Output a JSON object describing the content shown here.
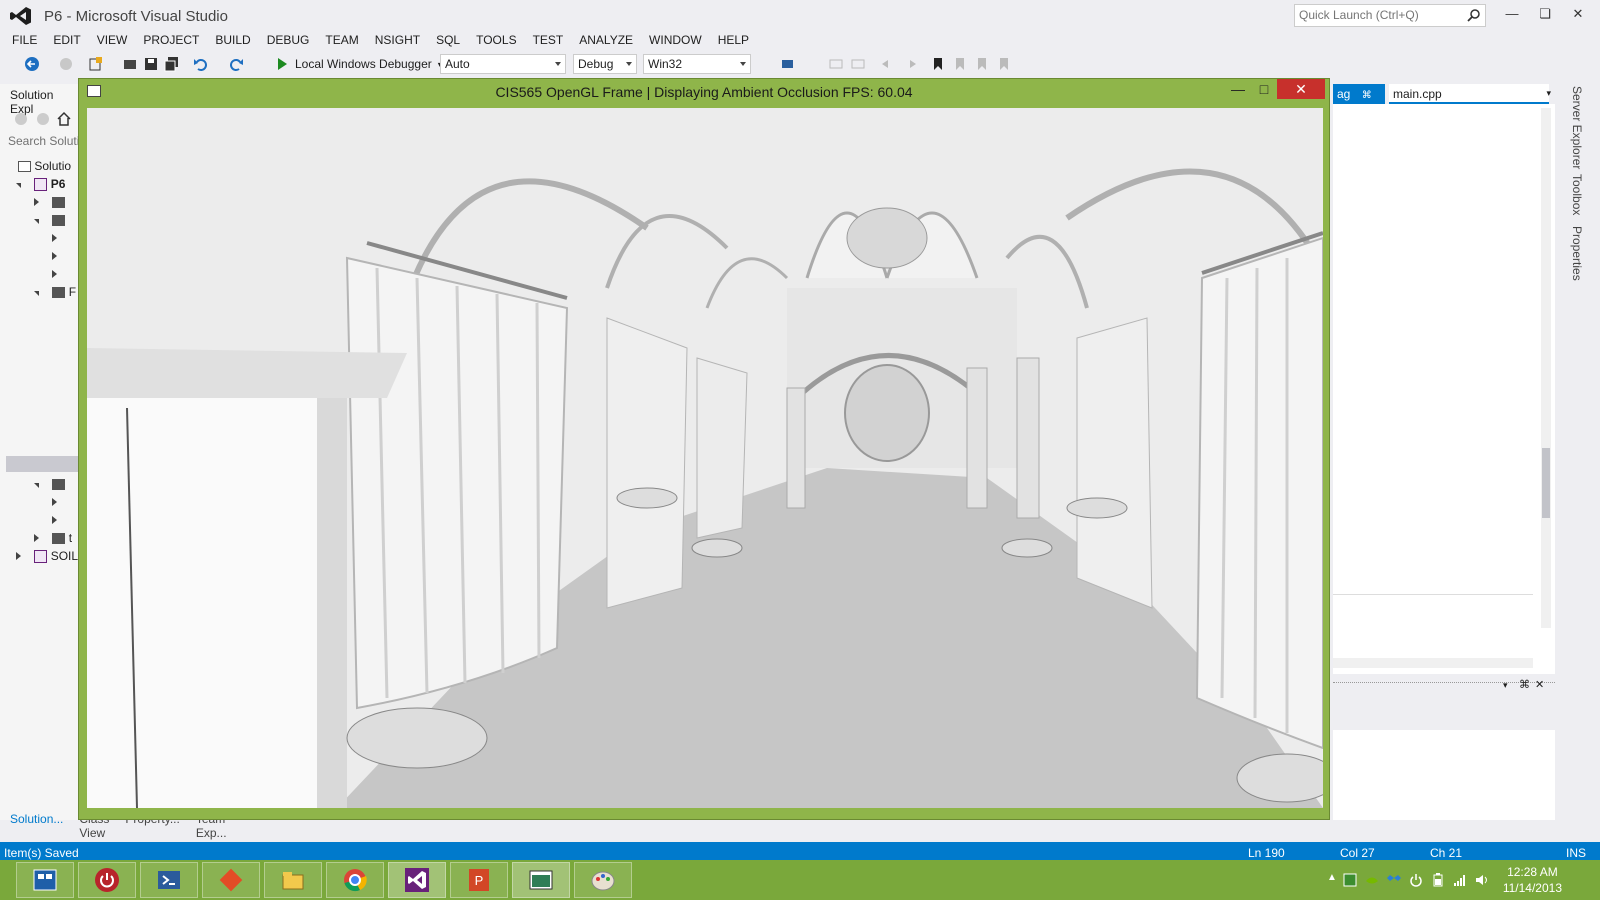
{
  "app": {
    "title": "P6 - Microsoft Visual Studio",
    "quick_launch_placeholder": "Quick Launch (Ctrl+Q)"
  },
  "menu": [
    "FILE",
    "EDIT",
    "VIEW",
    "PROJECT",
    "BUILD",
    "DEBUG",
    "TEAM",
    "NSIGHT",
    "SQL",
    "TOOLS",
    "TEST",
    "ANALYZE",
    "WINDOW",
    "HELP"
  ],
  "toolbar": {
    "debugger_label": "Local Windows Debugger",
    "config_auto": "Auto",
    "config_debug": "Debug",
    "platform": "Win32"
  },
  "solution_explorer": {
    "title": "Solution Expl",
    "search_placeholder": "Search Soluti",
    "solution_label": "Solutio",
    "project_label": "P6",
    "row_f": "F",
    "row_t": "t",
    "soil_label": "SOIL",
    "bottom_tabs": [
      "Solution...",
      "Class View",
      "Property...",
      "Team Exp..."
    ]
  },
  "editor": {
    "tab_partial": "ag",
    "tab_main": "main.cpp"
  },
  "side_rail": [
    "Server Explorer",
    "Toolbox",
    "Properties"
  ],
  "gl_window": {
    "title": "CIS565 OpenGL Frame | Displaying Ambient Occlusion FPS: 60.04"
  },
  "status": {
    "message": "Item(s) Saved",
    "line": "Ln 190",
    "col": "Col 27",
    "ch": "Ch 21",
    "mode": "INS"
  },
  "clock": {
    "time": "12:28 AM",
    "date": "11/14/2013"
  },
  "colors": {
    "accent": "#007acc",
    "taskbar": "#7aa83b",
    "gl_frame": "#8fb54a",
    "close": "#c7302c"
  }
}
